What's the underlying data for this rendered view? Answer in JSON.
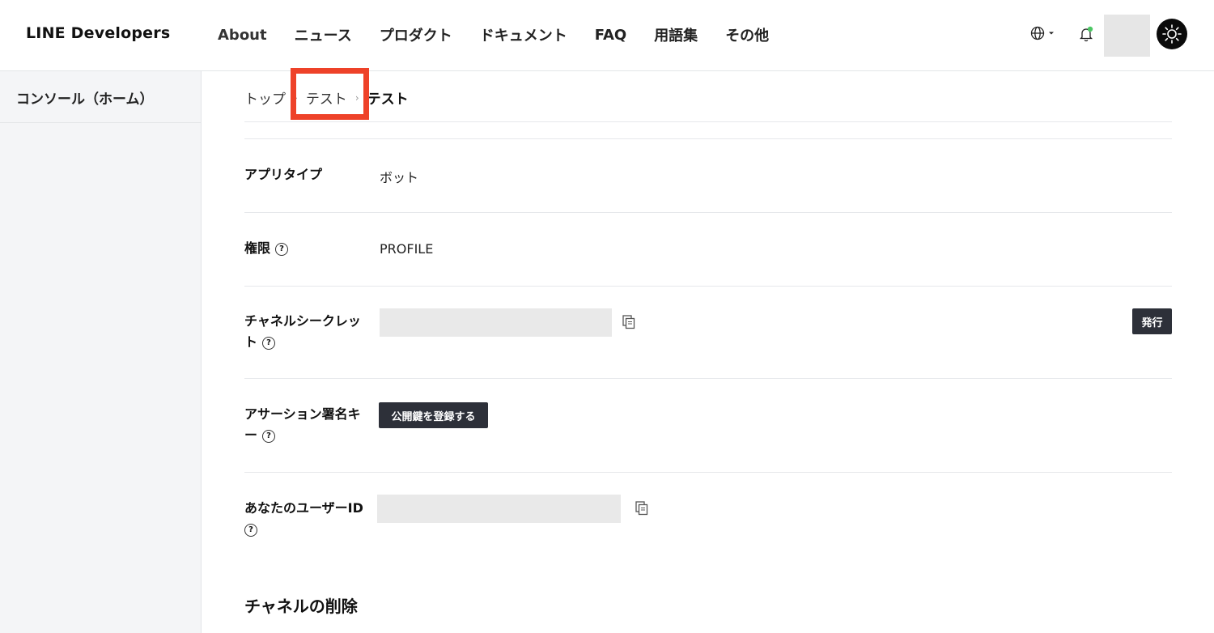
{
  "header": {
    "logo": "LINE Developers",
    "nav": [
      "About",
      "ニュース",
      "プロダクト",
      "ドキュメント",
      "FAQ",
      "用語集",
      "その他"
    ],
    "colors": {
      "notification_dot": "#4cc764",
      "theme_button": "#0b0b0b"
    },
    "icons": [
      "globe-icon",
      "bell-icon",
      "sun-icon"
    ]
  },
  "sidebar": {
    "items": [
      {
        "label": "コンソール（ホーム）"
      }
    ]
  },
  "breadcrumb": {
    "items": [
      "トップ",
      "テスト"
    ],
    "current": "テスト",
    "highlight_color": "#ee4229"
  },
  "rows": {
    "app_type": {
      "label": "アプリタイプ",
      "value": "ボット"
    },
    "permissions": {
      "label": "権限",
      "value": "PROFILE"
    },
    "channel_secret": {
      "label_line1": "チャネルシークレッ",
      "label_line2": "ト",
      "button": "発行"
    },
    "assertion_key": {
      "label_line1": "アサーション署名キ",
      "label_line2": "ー",
      "button": "公開鍵を登録する"
    },
    "user_id": {
      "label_line1": "あなたのユーザーID"
    }
  },
  "section": {
    "title": "チャネルの削除"
  },
  "help_glyph": "?"
}
